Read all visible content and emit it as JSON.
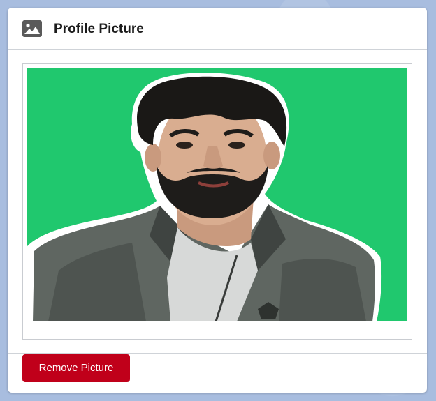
{
  "card": {
    "title": "Profile Picture",
    "title_icon": "image-icon"
  },
  "photo": {
    "subject": "profile-photo",
    "background_color": "#20c86e"
  },
  "actions": {
    "remove_label": "Remove Picture",
    "remove_color": "#c0001a"
  }
}
